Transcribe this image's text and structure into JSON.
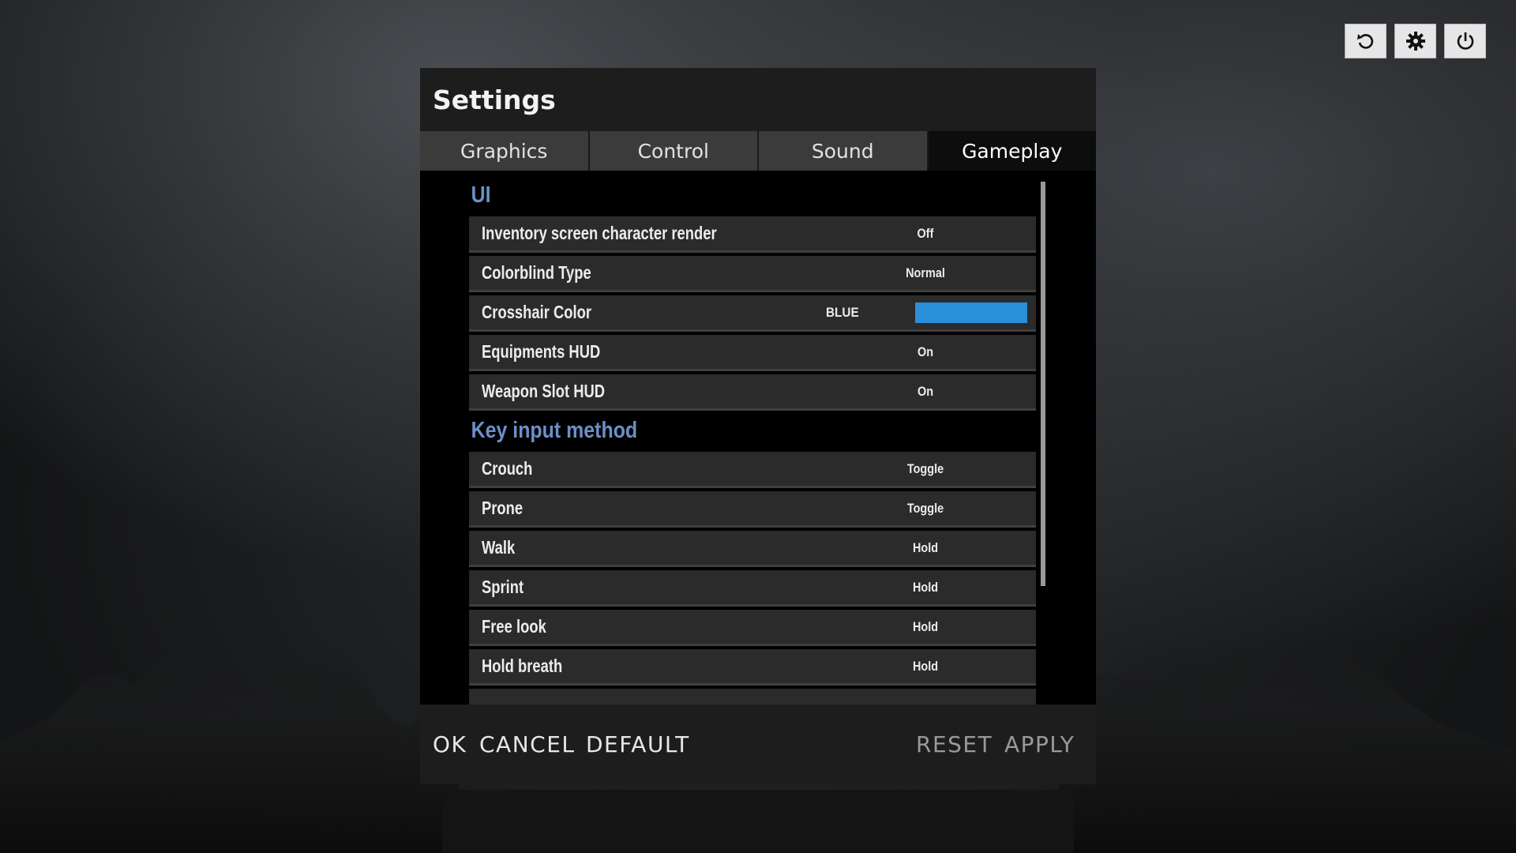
{
  "top_icons": [
    {
      "name": "refresh-icon"
    },
    {
      "name": "gear-icon"
    },
    {
      "name": "power-icon"
    }
  ],
  "panel": {
    "title": "Settings"
  },
  "tabs": [
    {
      "label": "Graphics",
      "active": false
    },
    {
      "label": "Control",
      "active": false
    },
    {
      "label": "Sound",
      "active": false
    },
    {
      "label": "Gameplay",
      "active": true
    }
  ],
  "sections": {
    "ui": {
      "title": "UI",
      "rows": [
        {
          "label": "Inventory screen character render",
          "value": "Off"
        },
        {
          "label": "Colorblind Type",
          "value": "Normal"
        },
        {
          "label": "Crosshair Color",
          "value": "BLUE",
          "swatch": "#2a8fd9"
        },
        {
          "label": "Equipments HUD",
          "value": "On"
        },
        {
          "label": "Weapon Slot HUD",
          "value": "On"
        }
      ]
    },
    "key_input": {
      "title": "Key input method",
      "rows": [
        {
          "label": "Crouch",
          "value": "Toggle"
        },
        {
          "label": "Prone",
          "value": "Toggle"
        },
        {
          "label": "Walk",
          "value": "Hold"
        },
        {
          "label": "Sprint",
          "value": "Hold"
        },
        {
          "label": "Free look",
          "value": "Hold"
        },
        {
          "label": "Hold breath",
          "value": "Hold"
        }
      ]
    }
  },
  "footer": {
    "ok": "OK",
    "cancel": "CANCEL",
    "default": "DEFAULT",
    "reset": "RESET",
    "apply": "APPLY"
  },
  "colors": {
    "section_title": "#6c8fc7",
    "crosshair_swatch": "#2a8fd9"
  }
}
